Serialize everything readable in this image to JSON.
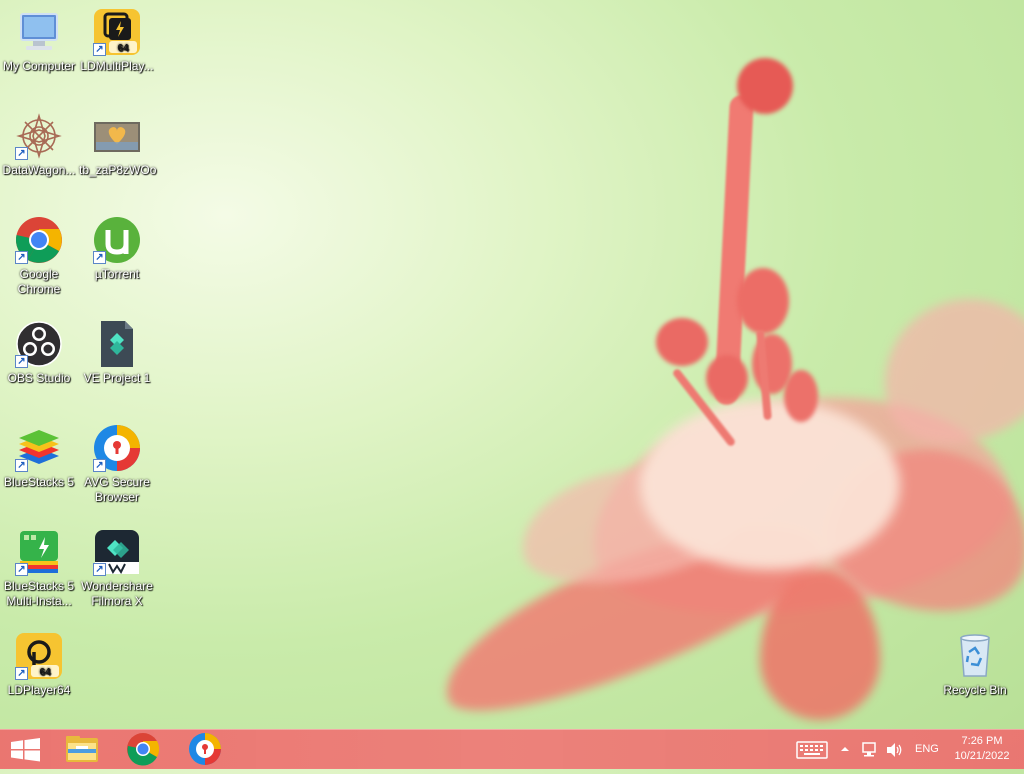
{
  "desktop_icons": [
    {
      "label": "My Computer",
      "icon": "computer-icon"
    },
    {
      "label": "LDMultiPlay...",
      "icon": "ldmultiplayer-icon",
      "badge": "64"
    },
    {
      "label": "DataWagon...",
      "icon": "datawagon-icon"
    },
    {
      "label": "tb_zaP8zWOo",
      "icon": "image-thumbnail-icon"
    },
    {
      "label": "Google Chrome",
      "icon": "chrome-icon"
    },
    {
      "label": "µTorrent",
      "icon": "utorrent-icon"
    },
    {
      "label": "OBS Studio",
      "icon": "obs-icon"
    },
    {
      "label": "VE Project 1",
      "icon": "filmora-project-file-icon"
    },
    {
      "label": "BlueStacks 5",
      "icon": "bluestacks-icon"
    },
    {
      "label": "AVG Secure Browser",
      "icon": "avg-browser-icon"
    },
    {
      "label": "BlueStacks 5 Multi-Insta...",
      "icon": "bluestacks-multi-instance-icon"
    },
    {
      "label": "Wondershare Filmora X",
      "icon": "filmora-icon"
    },
    {
      "label": "LDPlayer64",
      "icon": "ldplayer-icon",
      "badge": "64"
    },
    {
      "label": "Recycle Bin",
      "icon": "recycle-bin-icon"
    }
  ],
  "shortcut_arrow": "↗",
  "taskbar": {
    "pinned": [
      "start-icon",
      "file-explorer-icon",
      "chrome-icon",
      "avg-browser-icon"
    ],
    "tray": {
      "language": "ENG",
      "time": "7:26 PM",
      "date": "10/21/2022"
    }
  },
  "colors": {
    "taskbar": "#ee6c6c",
    "wallpaper_green": "#c9ebaa",
    "flower_pink": "#f07a72"
  }
}
